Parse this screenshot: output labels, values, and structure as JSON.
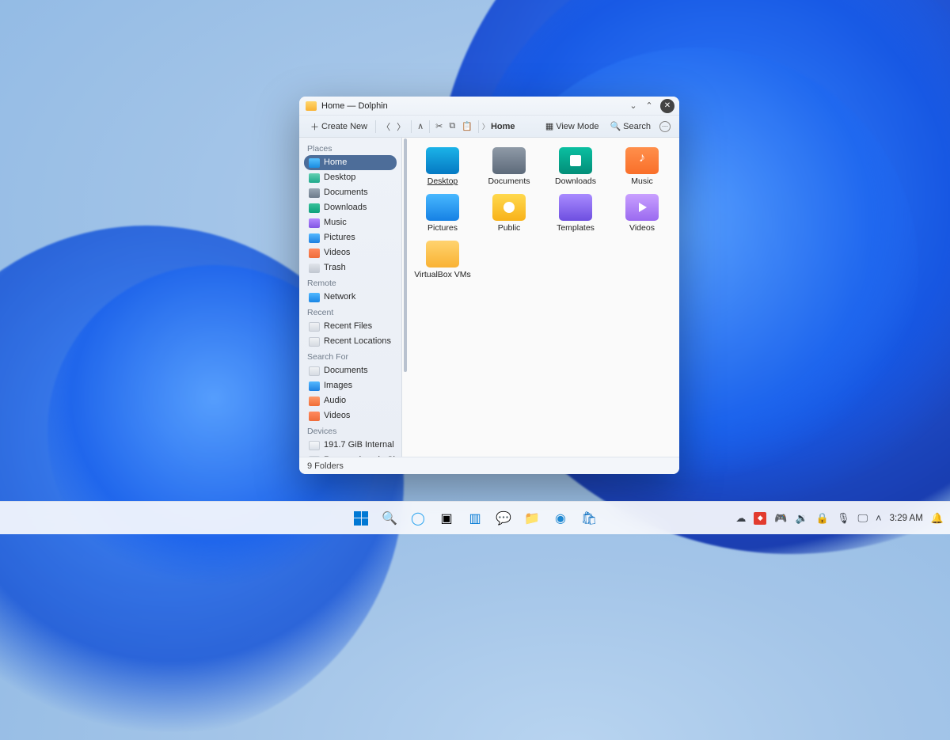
{
  "window": {
    "title": "Home — Dolphin",
    "toolbar": {
      "create_new": "Create New",
      "view_mode": "View Mode",
      "search": "Search",
      "breadcrumb_current": "Home"
    },
    "status": "9 Folders"
  },
  "sidebar": {
    "sections": {
      "places": "Places",
      "remote": "Remote",
      "recent": "Recent",
      "search_for": "Search For",
      "devices": "Devices"
    },
    "places": [
      {
        "label": "Home",
        "icon": "si-home",
        "active": true
      },
      {
        "label": "Desktop",
        "icon": "si-desktop"
      },
      {
        "label": "Documents",
        "icon": "si-docs"
      },
      {
        "label": "Downloads",
        "icon": "si-down"
      },
      {
        "label": "Music",
        "icon": "si-music"
      },
      {
        "label": "Pictures",
        "icon": "si-pics"
      },
      {
        "label": "Videos",
        "icon": "si-vids"
      },
      {
        "label": "Trash",
        "icon": "si-trash"
      }
    ],
    "remote": [
      {
        "label": "Network",
        "icon": "si-net"
      }
    ],
    "recent": [
      {
        "label": "Recent Files",
        "icon": "si-file"
      },
      {
        "label": "Recent Locations",
        "icon": "si-file"
      }
    ],
    "search_for": [
      {
        "label": "Documents",
        "icon": "si-file"
      },
      {
        "label": "Images",
        "icon": "si-pics"
      },
      {
        "label": "Audio",
        "icon": "si-audio"
      },
      {
        "label": "Videos",
        "icon": "si-vids"
      }
    ],
    "devices": [
      {
        "label": "191.7 GiB Internal ...",
        "icon": "si-drive"
      },
      {
        "label": "Reservado pelo Si...",
        "icon": "si-drive"
      }
    ]
  },
  "folders": [
    {
      "label": "Desktop",
      "icon": "bi-desktop",
      "selected": true
    },
    {
      "label": "Documents",
      "icon": "bi-docs"
    },
    {
      "label": "Downloads",
      "icon": "bi-down"
    },
    {
      "label": "Music",
      "icon": "bi-music"
    },
    {
      "label": "Pictures",
      "icon": "bi-pics"
    },
    {
      "label": "Public",
      "icon": "bi-public"
    },
    {
      "label": "Templates",
      "icon": "bi-tmpl"
    },
    {
      "label": "Videos",
      "icon": "bi-vids"
    },
    {
      "label": "VirtualBox VMs",
      "icon": "bi-generic"
    }
  ],
  "taskbar": {
    "time": "3:29 AM"
  }
}
